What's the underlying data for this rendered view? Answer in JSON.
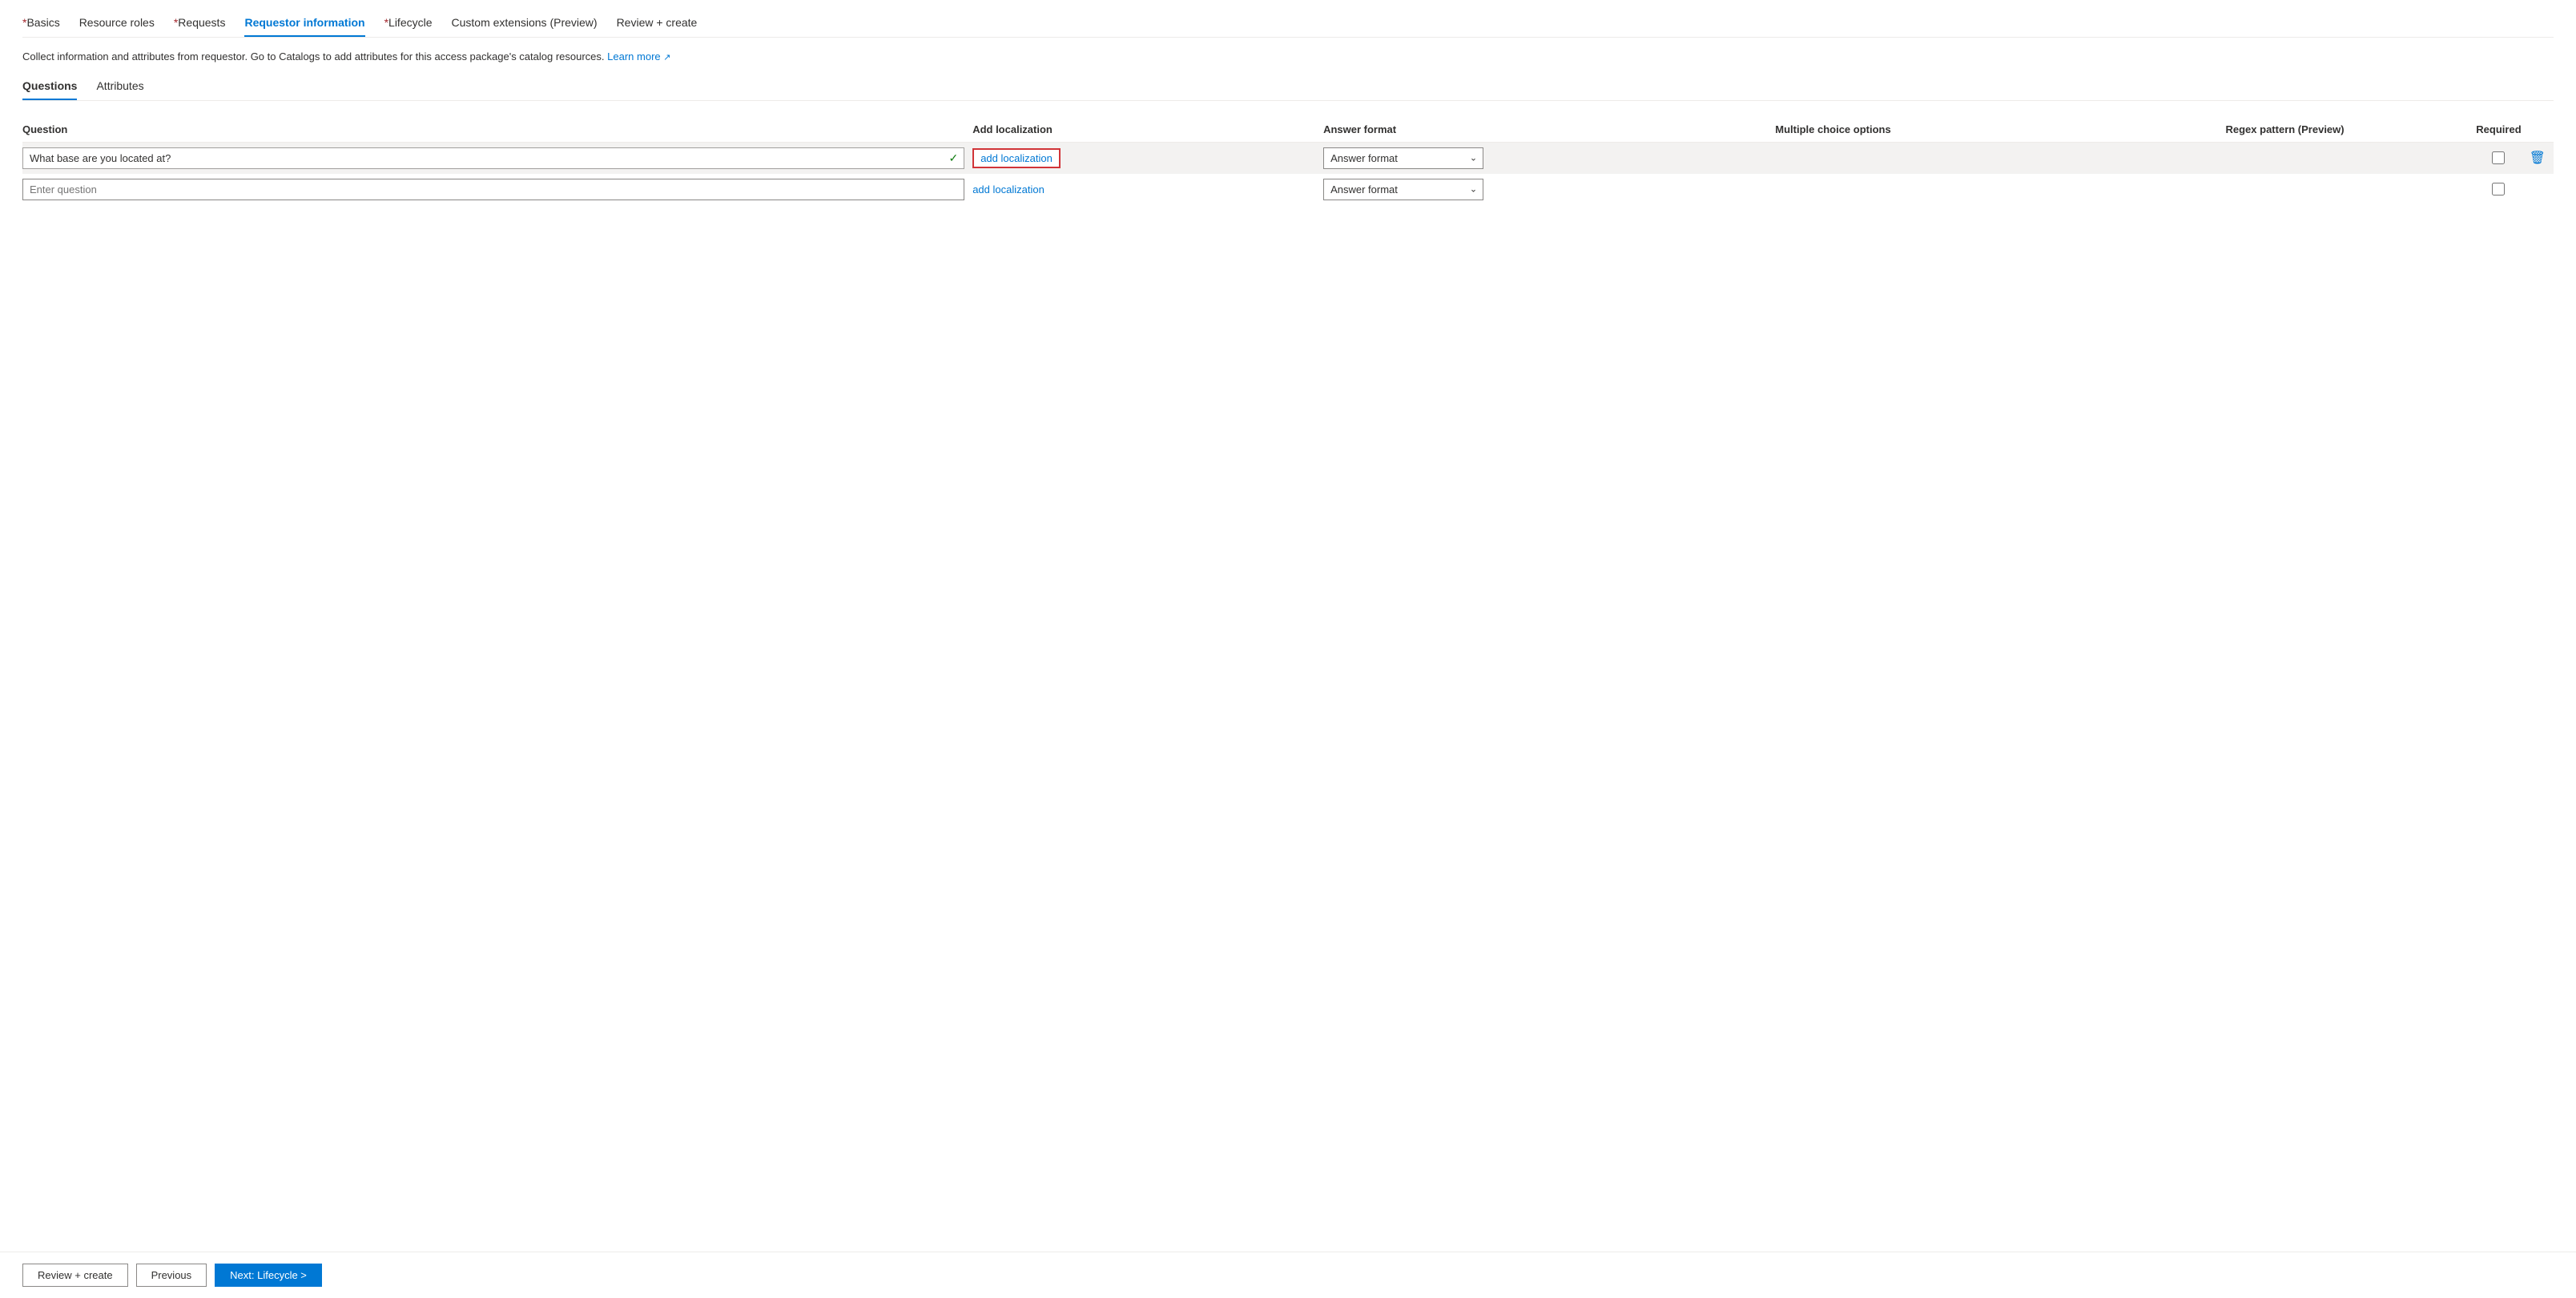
{
  "nav": {
    "tabs": [
      {
        "id": "basics",
        "label": "Basics",
        "required": true,
        "active": false
      },
      {
        "id": "resource-roles",
        "label": "Resource roles",
        "required": false,
        "active": false
      },
      {
        "id": "requests",
        "label": "Requests",
        "required": true,
        "active": false
      },
      {
        "id": "requestor-information",
        "label": "Requestor information",
        "required": false,
        "active": true
      },
      {
        "id": "lifecycle",
        "label": "Lifecycle",
        "required": true,
        "active": false
      },
      {
        "id": "custom-extensions",
        "label": "Custom extensions (Preview)",
        "required": false,
        "active": false
      },
      {
        "id": "review-create",
        "label": "Review + create",
        "required": false,
        "active": false
      }
    ]
  },
  "description": {
    "text": "Collect information and attributes from requestor. Go to Catalogs to add attributes for this access package's catalog resources.",
    "link_text": "Learn more",
    "link_icon": "↗"
  },
  "sub_tabs": [
    {
      "id": "questions",
      "label": "Questions",
      "active": true
    },
    {
      "id": "attributes",
      "label": "Attributes",
      "active": false
    }
  ],
  "table": {
    "columns": [
      {
        "id": "question",
        "label": "Question"
      },
      {
        "id": "add-localization",
        "label": "Add localization"
      },
      {
        "id": "answer-format",
        "label": "Answer format"
      },
      {
        "id": "multiple-choice",
        "label": "Multiple choice options"
      },
      {
        "id": "regex",
        "label": "Regex pattern (Preview)"
      },
      {
        "id": "required",
        "label": "Required"
      }
    ],
    "rows": [
      {
        "id": "row1",
        "question_value": "What base are you located at?",
        "question_placeholder": "",
        "has_checkmark": true,
        "localization_highlighted": true,
        "localization_label": "add localization",
        "answer_format_value": "Answer format",
        "required_checked": false,
        "has_delete": true
      },
      {
        "id": "row2",
        "question_value": "",
        "question_placeholder": "Enter question",
        "has_checkmark": false,
        "localization_highlighted": false,
        "localization_label": "add localization",
        "answer_format_value": "Answer format",
        "required_checked": false,
        "has_delete": false
      }
    ]
  },
  "footer": {
    "review_create_label": "Review + create",
    "previous_label": "Previous",
    "next_label": "Next: Lifecycle >"
  }
}
